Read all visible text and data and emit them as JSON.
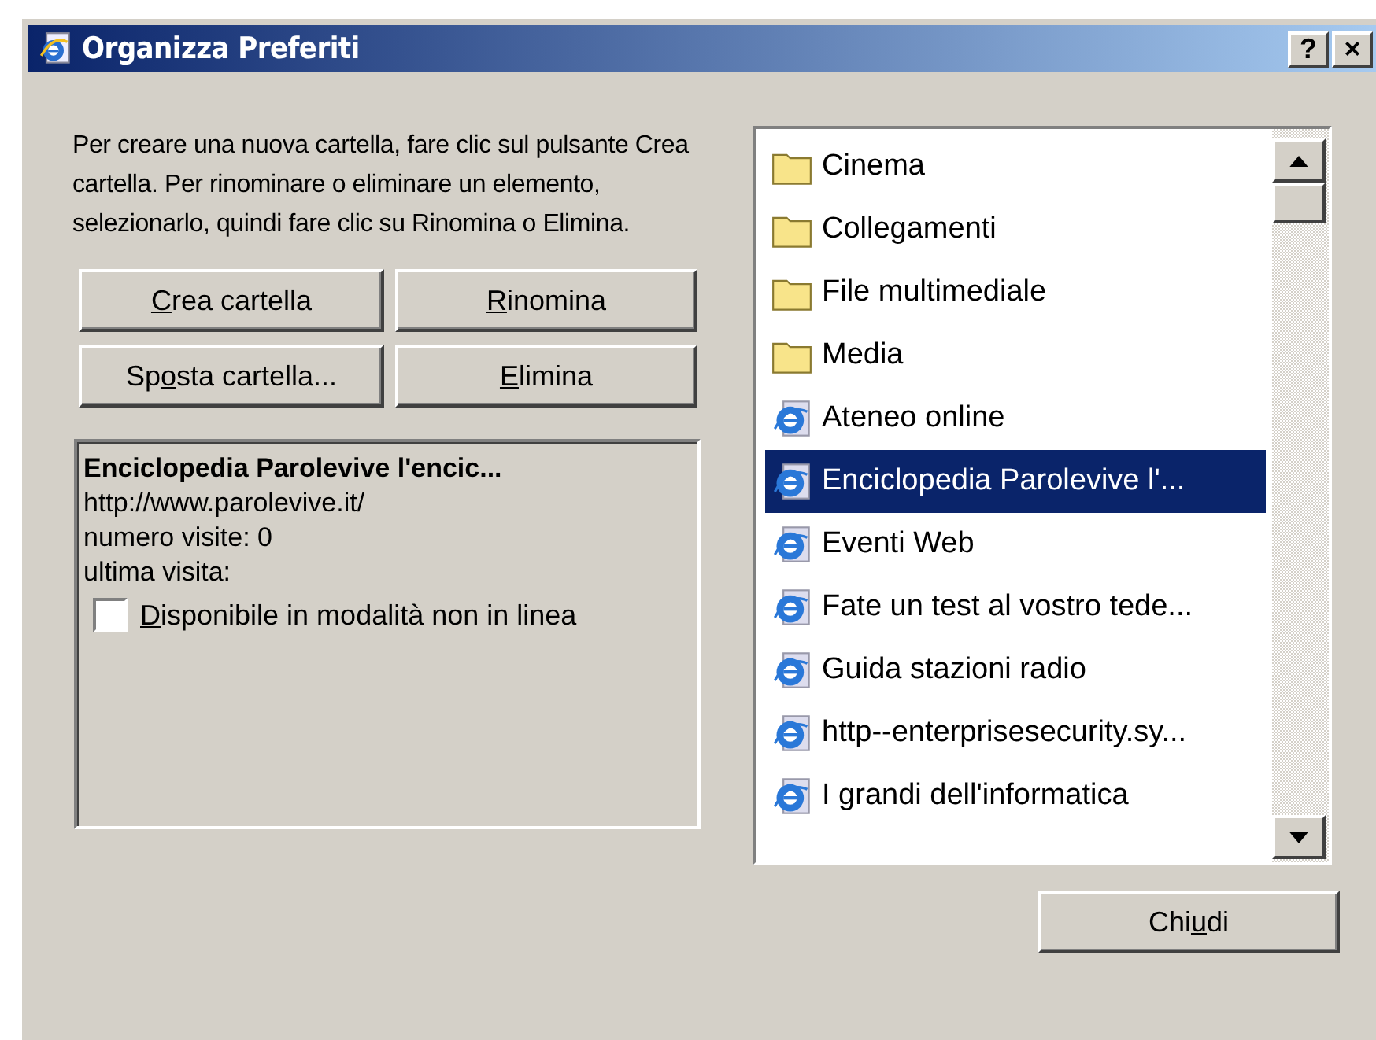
{
  "window": {
    "title": "Organizza Preferiti",
    "help_button": "?",
    "close_button": "×"
  },
  "instructions": "Per creare una nuova cartella, fare clic sul pulsante Crea cartella. Per rinominare o eliminare un elemento, selezionarlo, quindi fare clic su Rinomina o Elimina.",
  "buttons": [
    {
      "key": "C",
      "post": "rea cartella"
    },
    {
      "key": "R",
      "post": "inomina"
    },
    {
      "pre": "Sp",
      "key": "o",
      "post": "sta cartella..."
    },
    {
      "key": "E",
      "post": "limina"
    }
  ],
  "details": {
    "title": "Enciclopedia Parolevive l'encic...",
    "url": "http://www.parolevive.it/",
    "visits": "numero visite: 0",
    "last_visit": "ultima visita:",
    "offline": {
      "key": "D",
      "post": "isponibile in modalità non in linea",
      "checked": false
    }
  },
  "favorites": [
    {
      "kind": "folder",
      "label": "Cinema",
      "selected": false
    },
    {
      "kind": "folder",
      "label": "Collegamenti",
      "selected": false
    },
    {
      "kind": "folder",
      "label": "File multimediale",
      "selected": false
    },
    {
      "kind": "folder",
      "label": "Media",
      "selected": false
    },
    {
      "kind": "link",
      "label": "Ateneo online",
      "selected": false
    },
    {
      "kind": "link",
      "label": "Enciclopedia Parolevive l'...",
      "selected": true
    },
    {
      "kind": "link",
      "label": "Eventi Web",
      "selected": false
    },
    {
      "kind": "link",
      "label": "Fate un test al vostro tede...",
      "selected": false
    },
    {
      "kind": "link",
      "label": "Guida stazioni radio",
      "selected": false
    },
    {
      "kind": "link",
      "label": "http--enterprisesecurity.sy...",
      "selected": false
    },
    {
      "kind": "link",
      "label": "I grandi dell'informatica",
      "selected": false
    }
  ],
  "close": {
    "pre": "Chi",
    "key": "u",
    "post": "di"
  }
}
